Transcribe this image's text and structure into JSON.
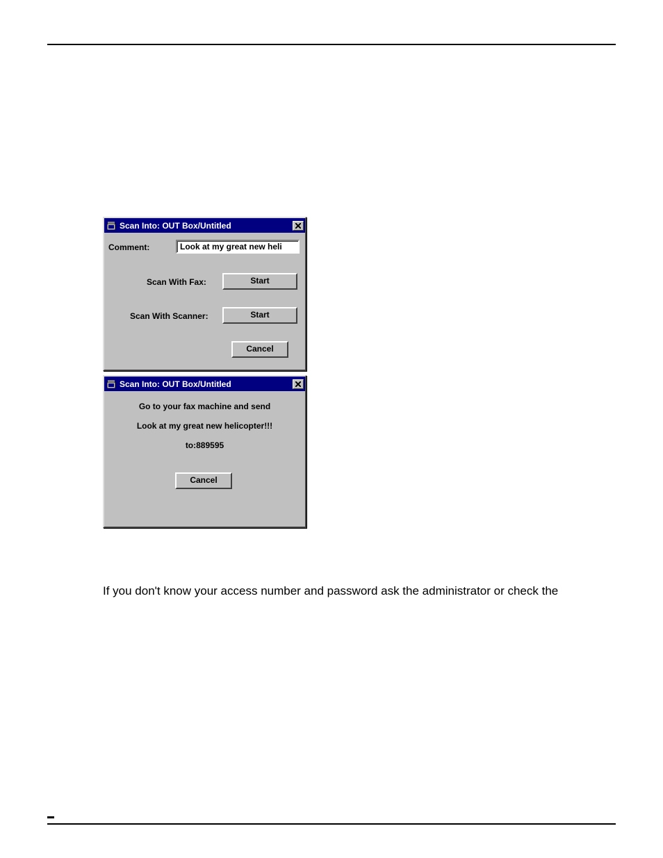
{
  "page": {
    "body_text": "If you don't know your access number and password ask the administrator or check the"
  },
  "dialog1": {
    "title": "Scan Into: OUT Box/Untitled",
    "comment_label": "Comment:",
    "comment_value": "Look at my great new heli",
    "scan_fax_label": "Scan With Fax:",
    "scan_fax_button": "Start",
    "scan_scanner_label": "Scan With Scanner:",
    "scan_scanner_button": "Start",
    "cancel_button": "Cancel"
  },
  "dialog2": {
    "title": "Scan Into: OUT Box/Untitled",
    "line1": "Go to your fax machine and send",
    "line2": "Look at my great new helicopter!!!",
    "line3": "to:889595",
    "cancel_button": "Cancel"
  }
}
